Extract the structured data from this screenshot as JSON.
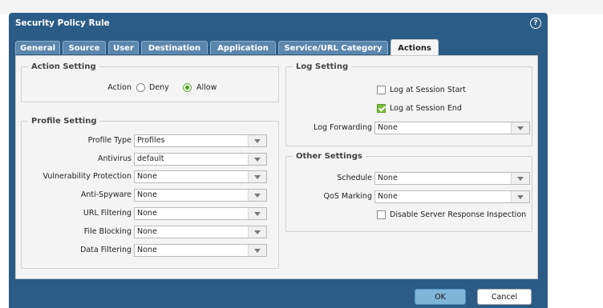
{
  "dialog": {
    "title": "Security Policy Rule",
    "help_icon": "?"
  },
  "tabs": [
    "General",
    "Source",
    "User",
    "Destination",
    "Application",
    "Service/URL Category",
    "Actions"
  ],
  "active_tab": "Actions",
  "action_setting": {
    "legend": "Action Setting",
    "label": "Action",
    "options": [
      "Deny",
      "Allow"
    ],
    "selected": "Allow"
  },
  "profile_setting": {
    "legend": "Profile Setting",
    "rows": [
      {
        "label": "Profile Type",
        "value": "Profiles"
      },
      {
        "label": "Antivirus",
        "value": "default"
      },
      {
        "label": "Vulnerability Protection",
        "value": "None"
      },
      {
        "label": "Anti-Spyware",
        "value": "None"
      },
      {
        "label": "URL Filtering",
        "value": "None"
      },
      {
        "label": "File Blocking",
        "value": "None"
      },
      {
        "label": "Data Filtering",
        "value": "None"
      }
    ]
  },
  "log_setting": {
    "legend": "Log Setting",
    "log_session_start": {
      "label": "Log at Session Start",
      "checked": false
    },
    "log_session_end": {
      "label": "Log at Session End",
      "checked": true
    },
    "log_forwarding": {
      "label": "Log Forwarding",
      "value": "None"
    }
  },
  "other_settings": {
    "legend": "Other Settings",
    "schedule": {
      "label": "Schedule",
      "value": "None"
    },
    "qos": {
      "label": "QoS Marking",
      "value": "None"
    },
    "disable_sri": {
      "label": "Disable Server Response Inspection",
      "checked": false
    }
  },
  "buttons": {
    "ok": "OK",
    "cancel": "Cancel"
  },
  "colors": {
    "header": "#2b5c87",
    "tab": "#5c87ad",
    "check": "#7dbb3a",
    "ok_button": "#7fb6d9"
  }
}
